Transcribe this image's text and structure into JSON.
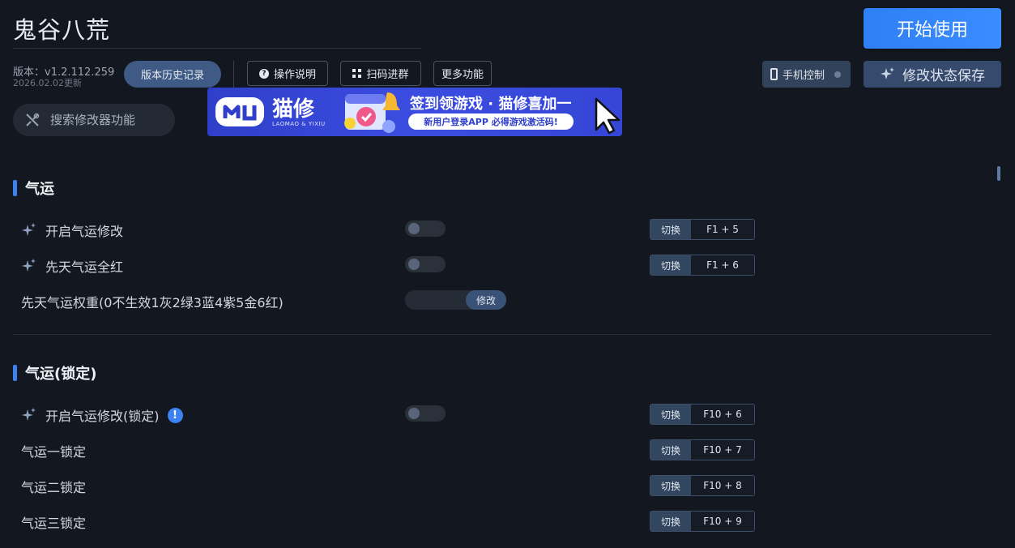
{
  "app": {
    "title": "鬼谷八荒",
    "start_button": "开始使用"
  },
  "version": {
    "label": "版本：v1.2.112.259",
    "update": "2026.02.02更新"
  },
  "toolbar": {
    "history": "版本历史记录",
    "instructions": "操作说明",
    "qr_group": "扫码进群",
    "more": "更多功能",
    "phone_control": "手机控制",
    "save_state": "修改状态保存"
  },
  "search": {
    "placeholder": "搜索修改器功能"
  },
  "banner": {
    "brand": "猫修",
    "brand_sub": "LAOMAO & YIXIU",
    "headline": "签到领游戏 · 猫修喜加一",
    "subline": "新用户登录APP  必得游戏激活码!"
  },
  "sections": [
    {
      "title": "气运",
      "rows": [
        {
          "label": "开启气运修改",
          "control": "toggle",
          "on": false,
          "hotkey_mode": "切换",
          "hotkey": "F1 + 5"
        },
        {
          "label": "先天气运全红",
          "control": "toggle",
          "on": false,
          "hotkey_mode": "切换",
          "hotkey": "F1 + 6"
        },
        {
          "label": "先天气运权重(0不生效1灰2绿3蓝4紫5金6红)",
          "control": "input",
          "button": "修改"
        }
      ]
    },
    {
      "title": "气运(锁定)",
      "rows": [
        {
          "label": "开启气运修改(锁定)",
          "control": "toggle",
          "on": false,
          "hotkey_mode": "切换",
          "hotkey": "F10 + 6"
        },
        {
          "label": "气运一锁定",
          "hotkey_mode": "切换",
          "hotkey": "F10 + 7"
        },
        {
          "label": "气运二锁定",
          "hotkey_mode": "切换",
          "hotkey": "F10 + 8"
        },
        {
          "label": "气运三锁定",
          "hotkey_mode": "切换",
          "hotkey": "F10 + 9"
        }
      ]
    }
  ],
  "colors": {
    "background": "#131820",
    "accent": "#3d82f0",
    "primary_button": "#2f7ff5"
  }
}
